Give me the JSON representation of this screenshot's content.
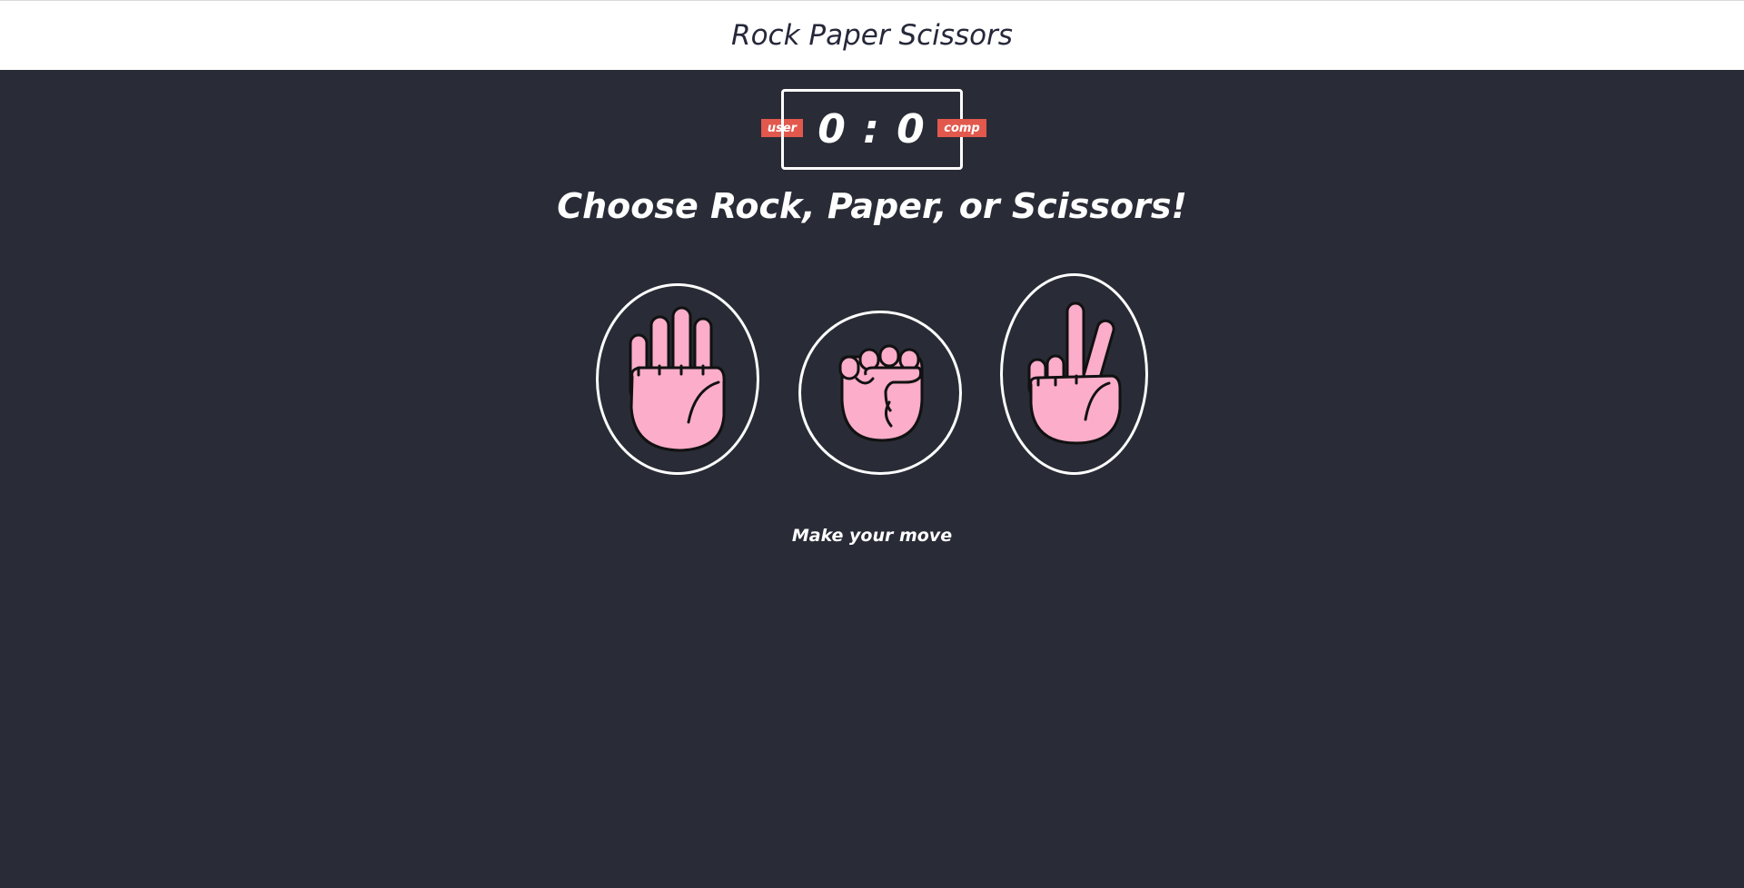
{
  "header": {
    "title": "Rock Paper Scissors"
  },
  "scoreboard": {
    "user_label": "user",
    "comp_label": "comp",
    "score_text": "0 : 0",
    "user_score": 0,
    "comp_score": 0,
    "badge_color": "#e2584d"
  },
  "prompt": "Choose Rock, Paper, or Scissors!",
  "choices": [
    {
      "id": "paper",
      "icon": "open-hand-icon"
    },
    {
      "id": "rock",
      "icon": "fist-icon"
    },
    {
      "id": "scissors",
      "icon": "peace-hand-icon"
    }
  ],
  "result_message": "Make your move",
  "colors": {
    "background": "#292c36",
    "header_background": "#ffffff",
    "hand_fill": "#fbadc9",
    "outline": "#ffffff"
  }
}
